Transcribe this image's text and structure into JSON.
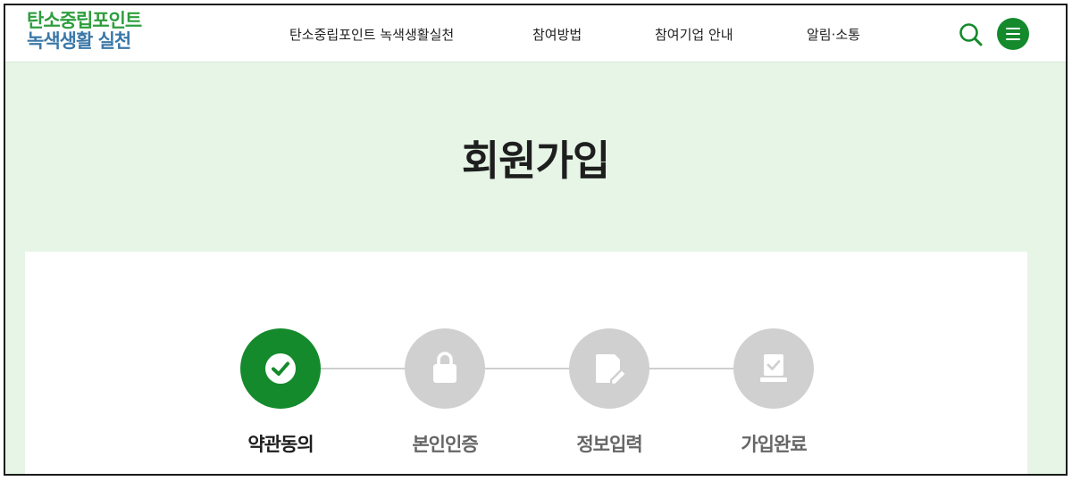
{
  "header": {
    "logo_line1": "탄소중립포인트",
    "logo_line2": "녹색생활 실천",
    "nav": [
      {
        "label": "탄소중립포인트 녹색생활실천"
      },
      {
        "label": "참여방법"
      },
      {
        "label": "참여기업 안내"
      },
      {
        "label": "알림·소통"
      }
    ],
    "search_icon": "search-icon",
    "menu_icon": "hamburger-icon"
  },
  "page": {
    "title": "회원가입"
  },
  "steps": [
    {
      "label": "약관동의",
      "icon": "check-icon",
      "status": "active"
    },
    {
      "label": "본인인증",
      "icon": "lock-icon",
      "status": "inactive"
    },
    {
      "label": "정보입력",
      "icon": "edit-document-icon",
      "status": "inactive"
    },
    {
      "label": "가입완료",
      "icon": "completed-document-icon",
      "status": "inactive"
    }
  ],
  "colors": {
    "brand_green": "#148a2c",
    "logo_green": "#2e9e3e",
    "logo_blue": "#3a78a8",
    "background_mint": "#e6f5e6",
    "inactive_gray": "#d0d0d0"
  }
}
